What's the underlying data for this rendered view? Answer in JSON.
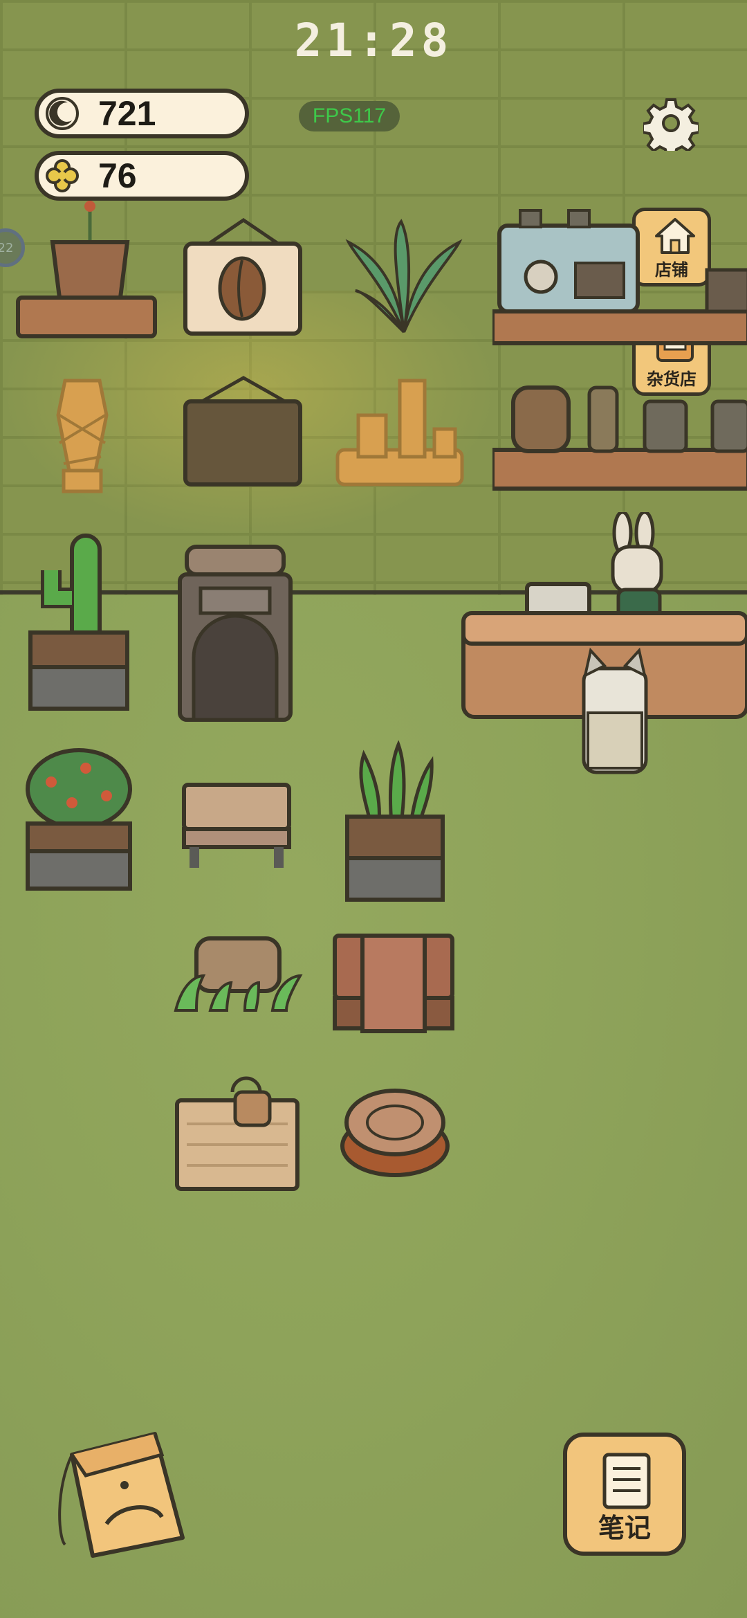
{
  "status": {
    "clock": "21:28",
    "fps": "FPS117"
  },
  "currency": {
    "moon_amount": "721",
    "clover_amount": "76"
  },
  "side_buttons": {
    "shop_label": "店铺",
    "grocery_label": "杂货店"
  },
  "bottom": {
    "notes_label": "笔记"
  },
  "left_badge": "22",
  "colors": {
    "wall": "#86954f",
    "floor": "#8ea35a",
    "pill_bg": "#fbf1dc",
    "button_bg": "#f2c77b",
    "outline": "#3a3527",
    "fps_text": "#3ec94a"
  }
}
